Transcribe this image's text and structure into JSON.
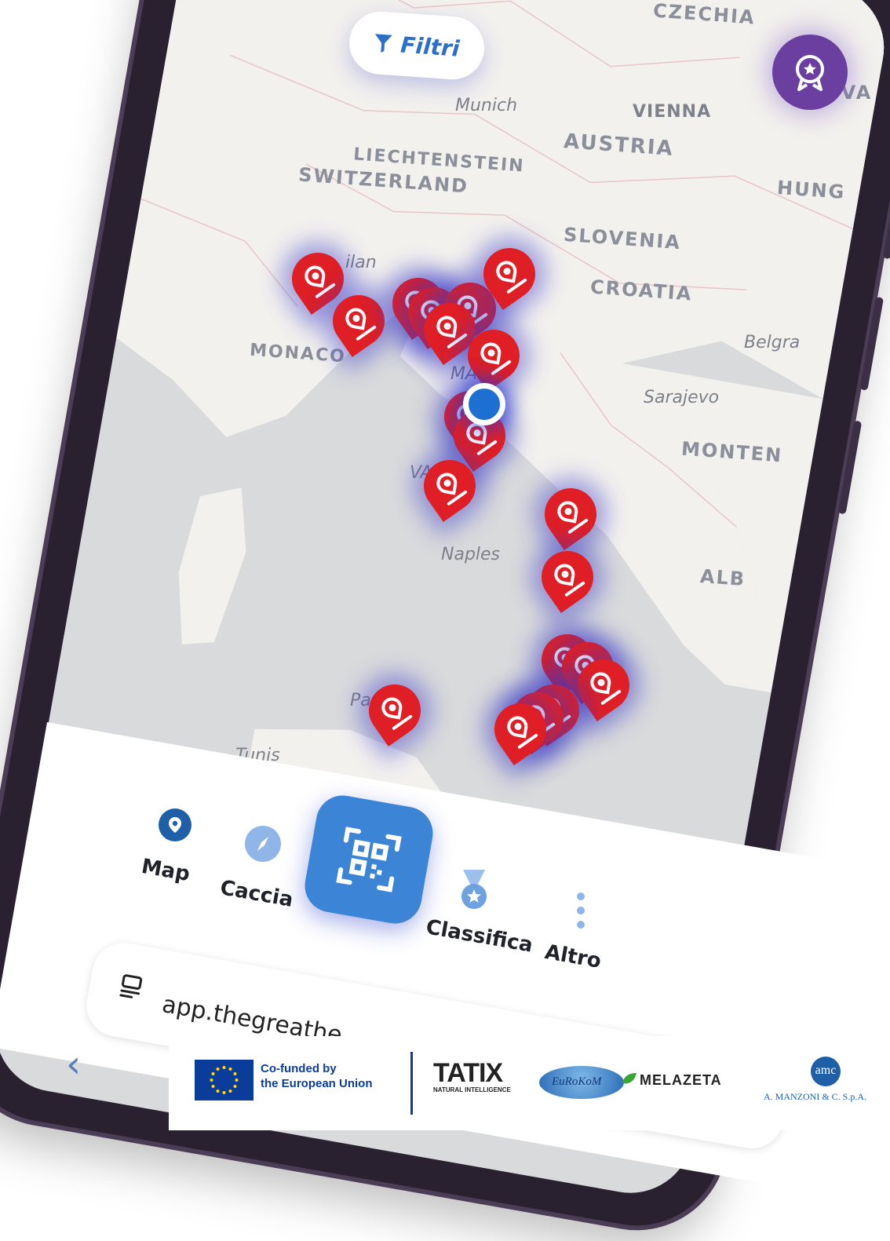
{
  "map": {
    "countries": {
      "czechia": "CZECHIA",
      "austria": "AUSTRIA",
      "liechtenstein": "LIECHTENSTEIN",
      "switzerland": "SWITZERLAND",
      "slovenia": "SLOVENIA",
      "croatia": "CROATIA",
      "hungary": "HUNG",
      "monaco": "MONACO",
      "montenegro": "MONTEN",
      "albania": "ALB",
      "slovakia": "OVA"
    },
    "cities": {
      "munich": "Munich",
      "vienna": "VIENNA",
      "milan": "ilan",
      "belgrade": "Belgra",
      "sarajevo": "Sarajevo",
      "naples": "Naples",
      "tunis": "Tunis",
      "palermo": "Pa",
      "vatican_partial": "VA",
      "san_marino_partial": "MA"
    },
    "filter_label": "Filtri",
    "pin_count": 22
  },
  "nav": {
    "map": "Map",
    "caccia": "Caccia",
    "classifica": "Classifica",
    "altro": "Altro"
  },
  "browser": {
    "url": "app.thegreathe..."
  },
  "footer": {
    "eu_line1": "Co-funded by",
    "eu_line2": "the European Union",
    "tatix": "TATIX",
    "tatix_sub": "NATURAL INTELLIGENCE",
    "eurokom": "EuRoKoM",
    "melazeta": "MELAZETA",
    "manzoni_logo": "amc",
    "manzoni": "A. MANZONI & C. S.p.A."
  },
  "colors": {
    "pin": "#e01e25",
    "accent_blue": "#3b84d6",
    "badge_purple": "#6a3fa0",
    "phone_frame": "#2a2130"
  }
}
